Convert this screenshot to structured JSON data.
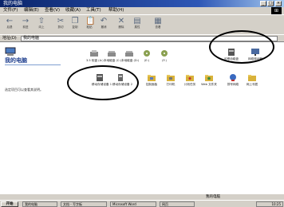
{
  "window": {
    "title": "我的电脑",
    "buttons": {
      "minimize": "_",
      "maximize": "□",
      "close": "×"
    }
  },
  "menu": [
    "文件(F)",
    "编辑(E)",
    "查看(V)",
    "收藏(A)",
    "工具(T)",
    "帮助(H)"
  ],
  "toolbar": {
    "items": [
      {
        "name": "back",
        "label": "后退",
        "glyph": "←"
      },
      {
        "name": "forward",
        "label": "前进",
        "glyph": "→"
      },
      {
        "name": "up",
        "label": "向上",
        "glyph": "⇧"
      },
      {
        "name": "cut",
        "label": "剪切",
        "glyph": "✂"
      },
      {
        "name": "copy",
        "label": "复制",
        "glyph": "❐"
      },
      {
        "name": "paste",
        "label": "粘贴",
        "glyph": "📋"
      },
      {
        "name": "undo",
        "label": "撤消",
        "glyph": "↶"
      },
      {
        "name": "delete",
        "label": "删除",
        "glyph": "✕"
      },
      {
        "name": "properties",
        "label": "属性",
        "glyph": "▤"
      },
      {
        "name": "views",
        "label": "查看",
        "glyph": "▦"
      }
    ]
  },
  "address": {
    "label": "地址(D)",
    "value": "我的电脑"
  },
  "left_panel": {
    "title": "我的电脑",
    "description": "选定项目可以查看其说明。"
  },
  "content": {
    "row1": [
      {
        "label": "3.5 软盘 (A:)",
        "color": "#8a8a8a"
      },
      {
        "label": "本地磁盘 (C:)",
        "color": "#8a8a8a"
      },
      {
        "label": "本地磁盘 (D:)",
        "color": "#8a8a8a"
      },
      {
        "label": "(E:)",
        "color": "#8aa050"
      },
      {
        "label": "(F:)",
        "color": "#8aa050"
      },
      {
        "label": "可移动磁盘",
        "color": "#555"
      },
      {
        "label": "网络驱动器",
        "color": "#4a6aa0"
      }
    ],
    "row2": [
      {
        "label": "移动存储设备 1",
        "color": "#555"
      },
      {
        "label": "移动存储设备 2",
        "color": "#555"
      },
      {
        "label": "控制面板",
        "color": "#d9b23a"
      },
      {
        "label": "打印机",
        "color": "#d9b23a"
      },
      {
        "label": "计划任务",
        "color": "#d9b23a"
      },
      {
        "label": "Web 文件夹",
        "color": "#d9b23a"
      },
      {
        "label": "拨号网络",
        "color": "#3a6ac0"
      },
      {
        "label": "网上邻居",
        "color": "#d9b23a"
      }
    ]
  },
  "status": {
    "text": "我的电脑"
  },
  "taskbar": {
    "start_label": "开始",
    "tasks": [
      "我的电脑",
      "文档 - 写字板",
      "Microsoft Word",
      "网页"
    ],
    "clock": "10:25"
  }
}
